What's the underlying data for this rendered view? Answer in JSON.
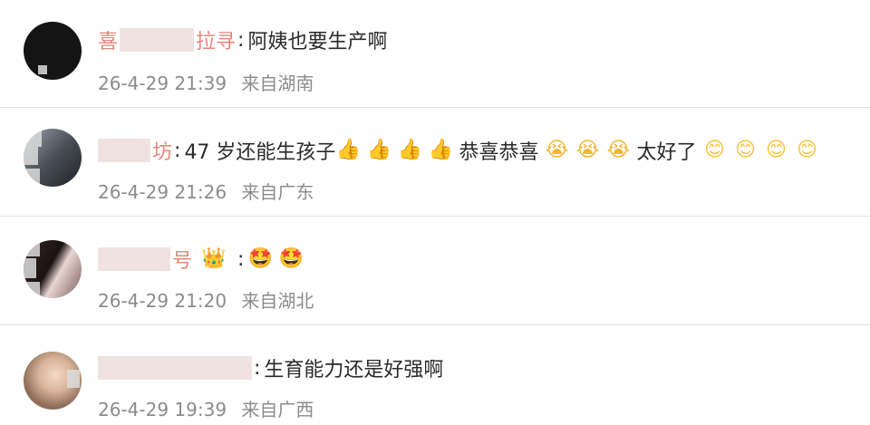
{
  "comments": [
    {
      "name_visible": "喜",
      "name_tail": "拉寻",
      "colon": ":",
      "text": "阿姨也要生产啊",
      "time": "26-4-29 21:39",
      "location": "来自湖南"
    },
    {
      "name_visible": "",
      "name_tail": "坊",
      "colon": ":",
      "text_a": "47 岁还能生孩子",
      "text_b": "恭喜恭喜",
      "text_c": "太好了",
      "emoji_thumb": "👍",
      "emoji_cry": "😭",
      "emoji_smile": "😊",
      "time": "26-4-29 21:26",
      "location": "来自广东"
    },
    {
      "name_visible": "",
      "name_tail": "号",
      "colon": ":",
      "emoji_crown": "👑",
      "emoji_shy": "🤩",
      "time": "26-4-29 21:20",
      "location": "来自湖北"
    },
    {
      "name_visible": "",
      "name_tail": "",
      "colon": ":",
      "text": "生育能力还是好强啊",
      "time": "26-4-29 19:39",
      "location": "来自广西"
    }
  ]
}
